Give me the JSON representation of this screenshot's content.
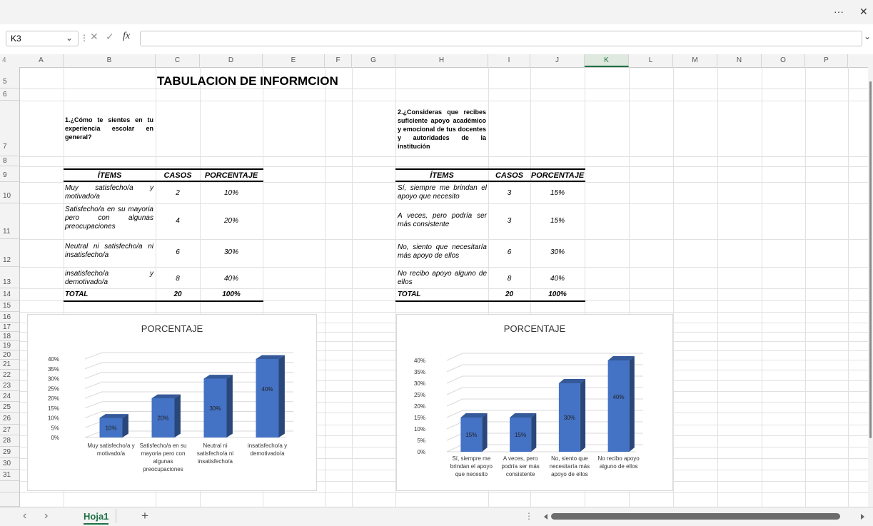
{
  "window": {
    "more": "···",
    "close": "✕"
  },
  "formula_bar": {
    "cell_ref": "K3",
    "dropdown": "⌄",
    "sep": "⋮",
    "cancel": "✕",
    "enter": "✓",
    "fx": "fx",
    "value": "",
    "expand": "⌄"
  },
  "columns": [
    "A",
    "B",
    "C",
    "D",
    "E",
    "F",
    "G",
    "H",
    "I",
    "J",
    "K",
    "L",
    "M",
    "N",
    "O",
    "P"
  ],
  "selected_column": "K",
  "rows": [
    "4",
    "5",
    "6",
    "7",
    "8",
    "9",
    "10",
    "11",
    "12",
    "13",
    "14",
    "15",
    "16",
    "17",
    "18",
    "19",
    "20",
    "21",
    "22",
    "23",
    "24",
    "25",
    "26",
    "27",
    "28",
    "29",
    "30",
    "31"
  ],
  "sheet": {
    "title": "TABULACION DE INFORMCION",
    "q1": "1.¿Cómo te sientes en tu experiencia escolar en general?",
    "q2": "2.¿Consideras que recibes suficiente apoyo académico y emocional de tus docentes y autoridades de la institución",
    "headers": {
      "items": "ÍTEMS",
      "casos": "CASOS",
      "porcentaje": "PORCENTAJE"
    },
    "table1": [
      {
        "item": "Muy satisfecho/a y motivado/a",
        "casos": "2",
        "pct": "10%"
      },
      {
        "item": "Satisfecho/a en su mayoria pero con algunas preocupaciones",
        "casos": "4",
        "pct": "20%"
      },
      {
        "item": "Neutral ni satisfecho/a ni insatisfecho/a",
        "casos": "6",
        "pct": "30%"
      },
      {
        "item": "insatisfecho/a y demotivado/a",
        "casos": "8",
        "pct": "40%"
      }
    ],
    "table1_total": {
      "label": "TOTAL",
      "casos": "20",
      "pct": "100%"
    },
    "table2": [
      {
        "item": "Sí, siempre me brindan el apoyo que necesito",
        "casos": "3",
        "pct": "15%"
      },
      {
        "item": "A veces, pero podría ser más consistente",
        "casos": "3",
        "pct": "15%"
      },
      {
        "item": "No, siento que necesitaría más apoyo de ellos",
        "casos": "6",
        "pct": "30%"
      },
      {
        "item": "No recibo apoyo alguno de ellos",
        "casos": "8",
        "pct": "40%"
      }
    ],
    "table2_total": {
      "label": "TOTAL",
      "casos": "20",
      "pct": "100%"
    }
  },
  "chart_data": [
    {
      "type": "bar",
      "title": "PORCENTAJE",
      "categories": [
        "Muy satisfecho/a y motivado/a",
        "Satisfecho/a en su mayoria pero con algunas preocupaciones",
        "Neutral ni satisfecho/a ni insatisfecho/a",
        "insatisfecho/a y demotivado/a"
      ],
      "category_lines": [
        [
          "Muy satisfecho/a y",
          "motivado/a"
        ],
        [
          "Satisfecho/a en su",
          "mayoria pero con",
          "algunas",
          "preocupaciones"
        ],
        [
          "Neutral ni",
          "satisfecho/a ni",
          "insatisfecho/a"
        ],
        [
          "insatisfecho/a y",
          "demotivado/a"
        ]
      ],
      "values": [
        0.1,
        0.2,
        0.3,
        0.4
      ],
      "data_labels": [
        "10%",
        "20%",
        "30%",
        "40%"
      ],
      "yticks": [
        "0%",
        "5%",
        "10%",
        "15%",
        "20%",
        "25%",
        "30%",
        "35%",
        "40%"
      ],
      "ylim": [
        0,
        0.4
      ],
      "bar_color": "#4472c4",
      "grid": true,
      "style": "3d-column"
    },
    {
      "type": "bar",
      "title": "PORCENTAJE",
      "categories": [
        "Sí, siempre me brindan el apoyo que necesito",
        "A veces, pero podría ser más consistente",
        "No, siento que necesitaría más apoyo de ellos",
        "No recibo apoyo alguno de ellos"
      ],
      "category_lines": [
        [
          "Sí, siempre me",
          "brindan el apoyo",
          "que necesito"
        ],
        [
          "A veces, pero",
          "podría ser más",
          "consistente"
        ],
        [
          "No, siento que",
          "necesitaría más",
          "apoyo de ellos"
        ],
        [
          "No recibo apoyo",
          "alguno de ellos"
        ]
      ],
      "values": [
        0.15,
        0.15,
        0.3,
        0.4
      ],
      "data_labels": [
        "15%",
        "15%",
        "30%",
        "40%"
      ],
      "yticks": [
        "0%",
        "5%",
        "10%",
        "15%",
        "20%",
        "25%",
        "30%",
        "35%",
        "40%"
      ],
      "ylim": [
        0,
        0.4
      ],
      "bar_color": "#4472c4",
      "grid": true,
      "style": "3d-column"
    }
  ],
  "tabs": {
    "prev": "‹",
    "next": "›",
    "active": "Hoja1",
    "add": "+"
  }
}
